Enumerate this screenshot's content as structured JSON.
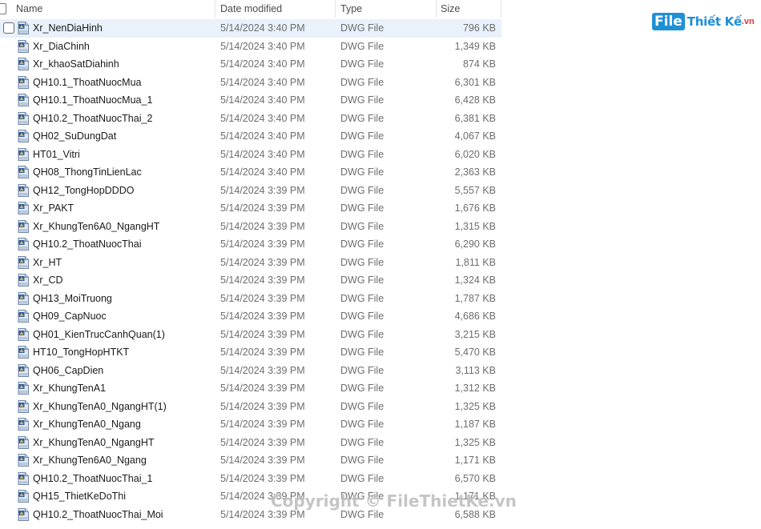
{
  "columns": {
    "name": "Name",
    "date": "Date modified",
    "type": "Type",
    "size": "Size"
  },
  "files": [
    {
      "name": "Xr_NenDiaHinh",
      "date": "5/14/2024 3:40 PM",
      "type": "DWG File",
      "size": "796 KB"
    },
    {
      "name": "Xr_DiaChinh",
      "date": "5/14/2024 3:40 PM",
      "type": "DWG File",
      "size": "1,349 KB"
    },
    {
      "name": "Xr_khaoSatDiahinh",
      "date": "5/14/2024 3:40 PM",
      "type": "DWG File",
      "size": "874 KB"
    },
    {
      "name": "QH10.1_ThoatNuocMua",
      "date": "5/14/2024 3:40 PM",
      "type": "DWG File",
      "size": "6,301 KB"
    },
    {
      "name": "QH10.1_ThoatNuocMua_1",
      "date": "5/14/2024 3:40 PM",
      "type": "DWG File",
      "size": "6,428 KB"
    },
    {
      "name": "QH10.2_ThoatNuocThai_2",
      "date": "5/14/2024 3:40 PM",
      "type": "DWG File",
      "size": "6,381 KB"
    },
    {
      "name": "QH02_SuDungDat",
      "date": "5/14/2024 3:40 PM",
      "type": "DWG File",
      "size": "4,067 KB"
    },
    {
      "name": "HT01_Vitri",
      "date": "5/14/2024 3:40 PM",
      "type": "DWG File",
      "size": "6,020 KB"
    },
    {
      "name": "QH08_ThongTinLienLac",
      "date": "5/14/2024 3:40 PM",
      "type": "DWG File",
      "size": "2,363 KB"
    },
    {
      "name": "QH12_TongHopDDDO",
      "date": "5/14/2024 3:39 PM",
      "type": "DWG File",
      "size": "5,557 KB"
    },
    {
      "name": "Xr_PAKT",
      "date": "5/14/2024 3:39 PM",
      "type": "DWG File",
      "size": "1,676 KB"
    },
    {
      "name": "Xr_KhungTen6A0_NgangHT",
      "date": "5/14/2024 3:39 PM",
      "type": "DWG File",
      "size": "1,315 KB"
    },
    {
      "name": "QH10.2_ThoatNuocThai",
      "date": "5/14/2024 3:39 PM",
      "type": "DWG File",
      "size": "6,290 KB"
    },
    {
      "name": "Xr_HT",
      "date": "5/14/2024 3:39 PM",
      "type": "DWG File",
      "size": "1,811 KB"
    },
    {
      "name": "Xr_CD",
      "date": "5/14/2024 3:39 PM",
      "type": "DWG File",
      "size": "1,324 KB"
    },
    {
      "name": "QH13_MoiTruong",
      "date": "5/14/2024 3:39 PM",
      "type": "DWG File",
      "size": "1,787 KB"
    },
    {
      "name": "QH09_CapNuoc",
      "date": "5/14/2024 3:39 PM",
      "type": "DWG File",
      "size": "4,686 KB"
    },
    {
      "name": "QH01_KienTrucCanhQuan(1)",
      "date": "5/14/2024 3:39 PM",
      "type": "DWG File",
      "size": "3,215 KB"
    },
    {
      "name": "HT10_TongHopHTKT",
      "date": "5/14/2024 3:39 PM",
      "type": "DWG File",
      "size": "5,470 KB"
    },
    {
      "name": "QH06_CapDien",
      "date": "5/14/2024 3:39 PM",
      "type": "DWG File",
      "size": "3,113 KB"
    },
    {
      "name": "Xr_KhungTenA1",
      "date": "5/14/2024 3:39 PM",
      "type": "DWG File",
      "size": "1,312 KB"
    },
    {
      "name": "Xr_KhungTenA0_NgangHT(1)",
      "date": "5/14/2024 3:39 PM",
      "type": "DWG File",
      "size": "1,325 KB"
    },
    {
      "name": "Xr_KhungTenA0_Ngang",
      "date": "5/14/2024 3:39 PM",
      "type": "DWG File",
      "size": "1,187 KB"
    },
    {
      "name": "Xr_KhungTenA0_NgangHT",
      "date": "5/14/2024 3:39 PM",
      "type": "DWG File",
      "size": "1,325 KB"
    },
    {
      "name": "Xr_KhungTen6A0_Ngang",
      "date": "5/14/2024 3:39 PM",
      "type": "DWG File",
      "size": "1,171 KB"
    },
    {
      "name": "QH10.2_ThoatNuocThai_1",
      "date": "5/14/2024 3:39 PM",
      "type": "DWG File",
      "size": "6,570 KB"
    },
    {
      "name": "QH15_ThietKeDoThi",
      "date": "5/14/2024 3:39 PM",
      "type": "DWG File",
      "size": "1,171 KB"
    },
    {
      "name": "QH10.2_ThoatNuocThai_Moi",
      "date": "5/14/2024 3:39 PM",
      "type": "DWG File",
      "size": "6,588 KB"
    }
  ],
  "logo": {
    "file": "File",
    "rest": "Thiết Kế",
    "suffix": ".vn"
  },
  "watermark": "Copyright © FileThietKe.vn",
  "icon": "dwg-file-icon",
  "colors": {
    "hover_row": "#e9f1fb",
    "logo_blue": "#1e90d6",
    "logo_red": "#e3342f"
  }
}
